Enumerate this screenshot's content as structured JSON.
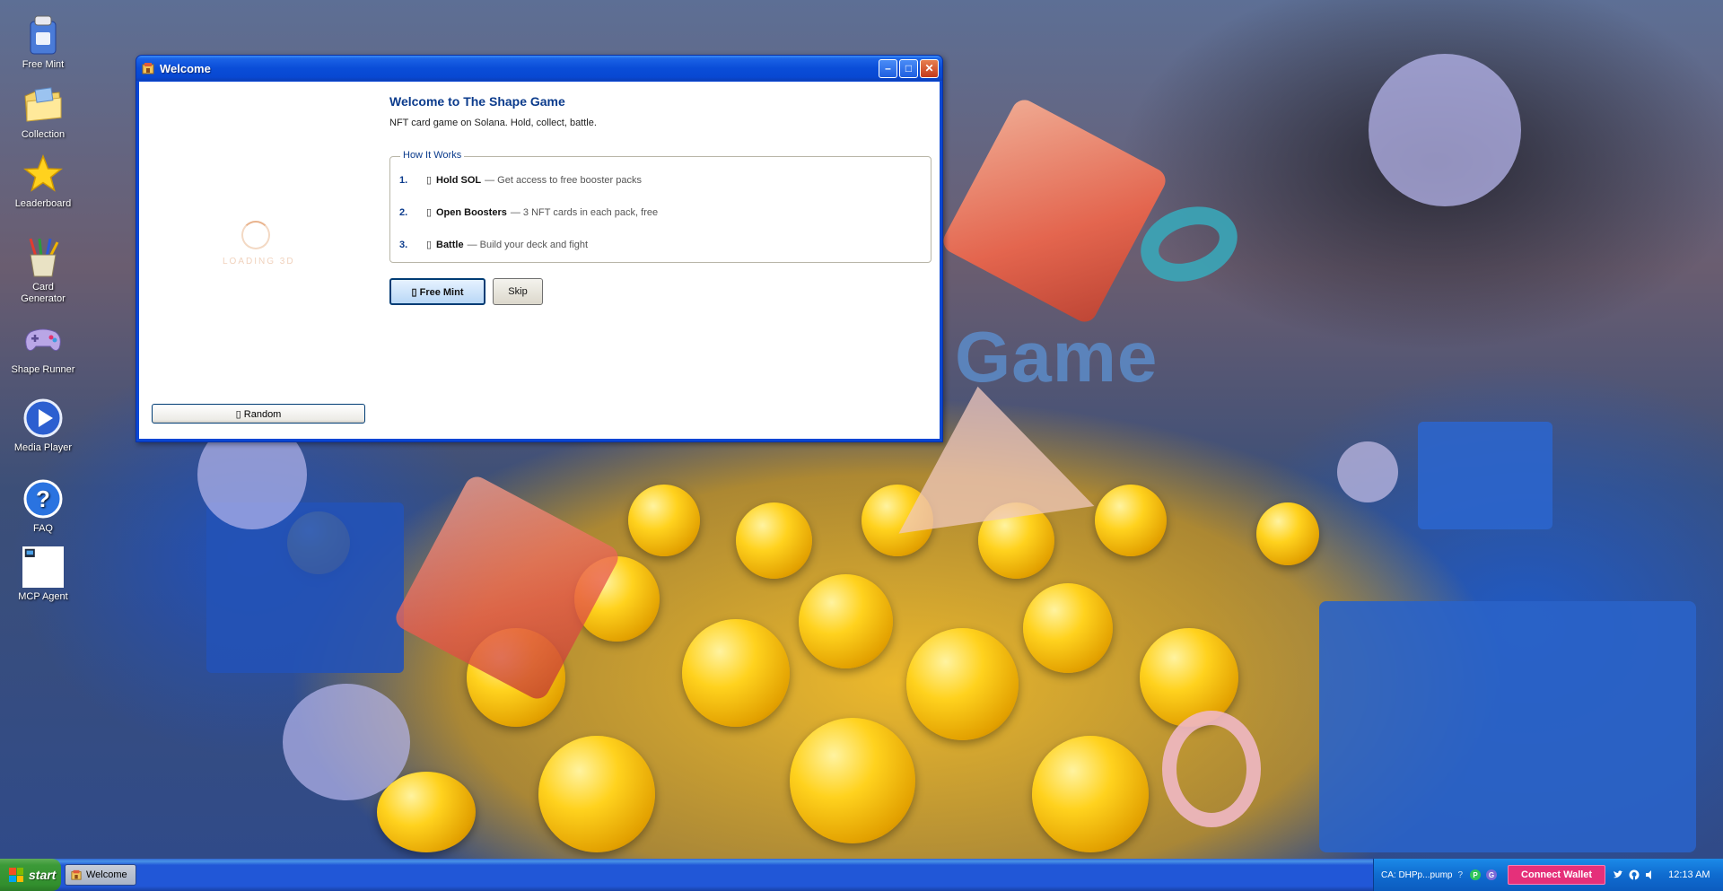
{
  "desktop": {
    "background_word": "Game",
    "icons": [
      {
        "label": "Free Mint"
      },
      {
        "label": "Collection"
      },
      {
        "label": "Leaderboard"
      },
      {
        "label": "Card Generator"
      },
      {
        "label": "Shape Runner"
      },
      {
        "label": "Media Player"
      },
      {
        "label": "FAQ"
      },
      {
        "label": "MCP Agent"
      }
    ]
  },
  "window": {
    "title": "Welcome",
    "left_pane": {
      "loading_text": "LOADING 3D",
      "random_button": "▯ Random"
    },
    "heading": "Welcome to The Shape Game",
    "subheading": "NFT card game on Solana. Hold, collect, battle.",
    "how_it_works": {
      "legend": "How It Works",
      "steps": [
        {
          "num": "1.",
          "icon": "▯",
          "title": "Hold SOL",
          "desc": "— Get access to free booster packs"
        },
        {
          "num": "2.",
          "icon": "▯",
          "title": "Open Boosters",
          "desc": "— 3 NFT cards in each pack, free"
        },
        {
          "num": "3.",
          "icon": "▯",
          "title": "Battle",
          "desc": "— Build your deck and fight"
        }
      ]
    },
    "buttons": {
      "free_mint": "▯ Free Mint",
      "skip": "Skip"
    }
  },
  "taskbar": {
    "start_label": "start",
    "task_button": "Welcome",
    "tray": {
      "ca_text": "CA: DHPp...pump",
      "ca_help": "?",
      "badge_p": "P",
      "badge_g": "G",
      "connect_wallet": "Connect Wallet",
      "clock": "12:13 AM"
    }
  },
  "colors": {
    "taskbar_blue": "#2157d7",
    "start_green": "#3c9a38",
    "connect_pink": "#e5307a",
    "title_text_blue": "#0b3b8c"
  }
}
